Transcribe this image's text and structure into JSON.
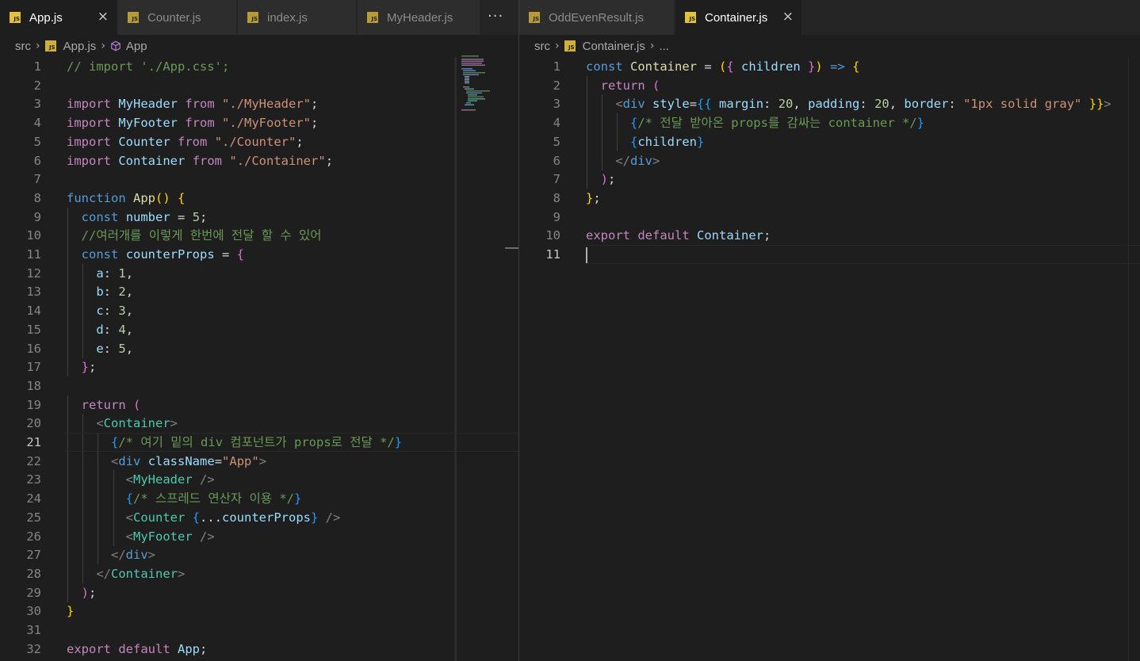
{
  "left_pane": {
    "tabs": [
      {
        "label": "App.js",
        "active": true,
        "close_icon": "×"
      },
      {
        "label": "Counter.js",
        "active": false
      },
      {
        "label": "index.js",
        "active": false
      },
      {
        "label": "MyHeader.js",
        "active": false
      }
    ],
    "more_tabs": "···",
    "breadcrumb": {
      "folder": "src",
      "file": "App.js",
      "symbol": "App"
    }
  },
  "right_pane": {
    "tabs": [
      {
        "label": "OddEvenResult.js",
        "active": false
      },
      {
        "label": "Container.js",
        "active": true,
        "close_icon": "×"
      }
    ],
    "breadcrumb": {
      "folder": "src",
      "file": "Container.js",
      "symbol": "..."
    }
  },
  "app_js": {
    "active_line": 21,
    "lines": [
      [
        {
          "t": "// import './App.css';",
          "c": "cmt"
        }
      ],
      [],
      [
        {
          "t": "import",
          "c": "ctl"
        },
        {
          "t": " "
        },
        {
          "t": "MyHeader",
          "c": "var"
        },
        {
          "t": " "
        },
        {
          "t": "from",
          "c": "ctl"
        },
        {
          "t": " "
        },
        {
          "t": "\"./MyHeader\"",
          "c": "str"
        },
        {
          "t": ";",
          "c": "pun"
        }
      ],
      [
        {
          "t": "import",
          "c": "ctl"
        },
        {
          "t": " "
        },
        {
          "t": "MyFooter",
          "c": "var"
        },
        {
          "t": " "
        },
        {
          "t": "from",
          "c": "ctl"
        },
        {
          "t": " "
        },
        {
          "t": "\"./MyFooter\"",
          "c": "str"
        },
        {
          "t": ";",
          "c": "pun"
        }
      ],
      [
        {
          "t": "import",
          "c": "ctl"
        },
        {
          "t": " "
        },
        {
          "t": "Counter",
          "c": "var"
        },
        {
          "t": " "
        },
        {
          "t": "from",
          "c": "ctl"
        },
        {
          "t": " "
        },
        {
          "t": "\"./Counter\"",
          "c": "str"
        },
        {
          "t": ";",
          "c": "pun"
        }
      ],
      [
        {
          "t": "import",
          "c": "ctl"
        },
        {
          "t": " "
        },
        {
          "t": "Container",
          "c": "var"
        },
        {
          "t": " "
        },
        {
          "t": "from",
          "c": "ctl"
        },
        {
          "t": " "
        },
        {
          "t": "\"./Container\"",
          "c": "str"
        },
        {
          "t": ";",
          "c": "pun"
        }
      ],
      [],
      [
        {
          "t": "function",
          "c": "kw"
        },
        {
          "t": " "
        },
        {
          "t": "App",
          "c": "fn"
        },
        {
          "t": "()",
          "c": "br1"
        },
        {
          "t": " "
        },
        {
          "t": "{",
          "c": "br1"
        }
      ],
      [
        {
          "t": "  "
        },
        {
          "t": "const",
          "c": "kw"
        },
        {
          "t": " "
        },
        {
          "t": "number",
          "c": "var"
        },
        {
          "t": " = ",
          "c": "pun"
        },
        {
          "t": "5",
          "c": "num"
        },
        {
          "t": ";",
          "c": "pun"
        }
      ],
      [
        {
          "t": "  "
        },
        {
          "t": "//여러개를 이렇게 한번에 전달 할 수 있어",
          "c": "cmt"
        }
      ],
      [
        {
          "t": "  "
        },
        {
          "t": "const",
          "c": "kw"
        },
        {
          "t": " "
        },
        {
          "t": "counterProps",
          "c": "var"
        },
        {
          "t": " = ",
          "c": "pun"
        },
        {
          "t": "{",
          "c": "br2"
        }
      ],
      [
        {
          "t": "    "
        },
        {
          "t": "a",
          "c": "var"
        },
        {
          "t": ": ",
          "c": "pun"
        },
        {
          "t": "1",
          "c": "num"
        },
        {
          "t": ",",
          "c": "pun"
        }
      ],
      [
        {
          "t": "    "
        },
        {
          "t": "b",
          "c": "var"
        },
        {
          "t": ": ",
          "c": "pun"
        },
        {
          "t": "2",
          "c": "num"
        },
        {
          "t": ",",
          "c": "pun"
        }
      ],
      [
        {
          "t": "    "
        },
        {
          "t": "c",
          "c": "var"
        },
        {
          "t": ": ",
          "c": "pun"
        },
        {
          "t": "3",
          "c": "num"
        },
        {
          "t": ",",
          "c": "pun"
        }
      ],
      [
        {
          "t": "    "
        },
        {
          "t": "d",
          "c": "var"
        },
        {
          "t": ": ",
          "c": "pun"
        },
        {
          "t": "4",
          "c": "num"
        },
        {
          "t": ",",
          "c": "pun"
        }
      ],
      [
        {
          "t": "    "
        },
        {
          "t": "e",
          "c": "var"
        },
        {
          "t": ": ",
          "c": "pun"
        },
        {
          "t": "5",
          "c": "num"
        },
        {
          "t": ",",
          "c": "pun"
        }
      ],
      [
        {
          "t": "  "
        },
        {
          "t": "}",
          "c": "br2"
        },
        {
          "t": ";",
          "c": "pun"
        }
      ],
      [],
      [
        {
          "t": "  "
        },
        {
          "t": "return",
          "c": "ctl"
        },
        {
          "t": " "
        },
        {
          "t": "(",
          "c": "br2"
        }
      ],
      [
        {
          "t": "    "
        },
        {
          "t": "<",
          "c": "ang"
        },
        {
          "t": "Container",
          "c": "tag"
        },
        {
          "t": ">",
          "c": "ang"
        }
      ],
      [
        {
          "t": "      "
        },
        {
          "t": "{",
          "c": "br3"
        },
        {
          "t": "/* 여기 밑의 div 컴포넌트가 props로 전달 */",
          "c": "cmt"
        },
        {
          "t": "}",
          "c": "br3"
        }
      ],
      [
        {
          "t": "      "
        },
        {
          "t": "<",
          "c": "ang"
        },
        {
          "t": "div",
          "c": "kw"
        },
        {
          "t": " "
        },
        {
          "t": "className",
          "c": "var"
        },
        {
          "t": "=",
          "c": "pun"
        },
        {
          "t": "\"App\"",
          "c": "str"
        },
        {
          "t": ">",
          "c": "ang"
        }
      ],
      [
        {
          "t": "        "
        },
        {
          "t": "<",
          "c": "ang"
        },
        {
          "t": "MyHeader",
          "c": "tag"
        },
        {
          "t": " />",
          "c": "ang"
        }
      ],
      [
        {
          "t": "        "
        },
        {
          "t": "{",
          "c": "br3"
        },
        {
          "t": "/* 스프레드 연산자 이용 */",
          "c": "cmt"
        },
        {
          "t": "}",
          "c": "br3"
        }
      ],
      [
        {
          "t": "        "
        },
        {
          "t": "<",
          "c": "ang"
        },
        {
          "t": "Counter",
          "c": "tag"
        },
        {
          "t": " "
        },
        {
          "t": "{",
          "c": "br3"
        },
        {
          "t": "...",
          "c": "pun"
        },
        {
          "t": "counterProps",
          "c": "var"
        },
        {
          "t": "}",
          "c": "br3"
        },
        {
          "t": " />",
          "c": "ang"
        }
      ],
      [
        {
          "t": "        "
        },
        {
          "t": "<",
          "c": "ang"
        },
        {
          "t": "MyFooter",
          "c": "tag"
        },
        {
          "t": " />",
          "c": "ang"
        }
      ],
      [
        {
          "t": "      "
        },
        {
          "t": "</",
          "c": "ang"
        },
        {
          "t": "div",
          "c": "kw"
        },
        {
          "t": ">",
          "c": "ang"
        }
      ],
      [
        {
          "t": "    "
        },
        {
          "t": "</",
          "c": "ang"
        },
        {
          "t": "Container",
          "c": "tag"
        },
        {
          "t": ">",
          "c": "ang"
        }
      ],
      [
        {
          "t": "  "
        },
        {
          "t": ")",
          "c": "br2"
        },
        {
          "t": ";",
          "c": "pun"
        }
      ],
      [
        {
          "t": "}",
          "c": "br1"
        }
      ],
      [],
      [
        {
          "t": "export",
          "c": "ctl"
        },
        {
          "t": " "
        },
        {
          "t": "default",
          "c": "ctl"
        },
        {
          "t": " "
        },
        {
          "t": "App",
          "c": "var"
        },
        {
          "t": ";",
          "c": "pun"
        }
      ]
    ]
  },
  "container_js": {
    "active_line": 11,
    "lines": [
      [
        {
          "t": "const",
          "c": "kw"
        },
        {
          "t": " "
        },
        {
          "t": "Container",
          "c": "fn"
        },
        {
          "t": " = ",
          "c": "pun"
        },
        {
          "t": "(",
          "c": "br1"
        },
        {
          "t": "{",
          "c": "br2"
        },
        {
          "t": " "
        },
        {
          "t": "children",
          "c": "var"
        },
        {
          "t": " "
        },
        {
          "t": "}",
          "c": "br2"
        },
        {
          "t": ")",
          "c": "br1"
        },
        {
          "t": " "
        },
        {
          "t": "=>",
          "c": "kw"
        },
        {
          "t": " "
        },
        {
          "t": "{",
          "c": "br1"
        }
      ],
      [
        {
          "t": "  "
        },
        {
          "t": "return",
          "c": "ctl"
        },
        {
          "t": " "
        },
        {
          "t": "(",
          "c": "br2"
        }
      ],
      [
        {
          "t": "    "
        },
        {
          "t": "<",
          "c": "ang"
        },
        {
          "t": "div",
          "c": "kw"
        },
        {
          "t": " "
        },
        {
          "t": "style",
          "c": "var"
        },
        {
          "t": "=",
          "c": "pun"
        },
        {
          "t": "{{",
          "c": "br3"
        },
        {
          "t": " "
        },
        {
          "t": "margin",
          "c": "var"
        },
        {
          "t": ": ",
          "c": "pun"
        },
        {
          "t": "20",
          "c": "num"
        },
        {
          "t": ", ",
          "c": "pun"
        },
        {
          "t": "padding",
          "c": "var"
        },
        {
          "t": ": ",
          "c": "pun"
        },
        {
          "t": "20",
          "c": "num"
        },
        {
          "t": ", ",
          "c": "pun"
        },
        {
          "t": "border",
          "c": "var"
        },
        {
          "t": ": ",
          "c": "pun"
        },
        {
          "t": "\"1px solid gray\"",
          "c": "str"
        },
        {
          "t": " "
        },
        {
          "t": "}}",
          "c": "br1"
        },
        {
          "t": ">",
          "c": "ang"
        }
      ],
      [
        {
          "t": "      "
        },
        {
          "t": "{",
          "c": "br3"
        },
        {
          "t": "/* 전달 받아온 props를 감싸는 container */",
          "c": "cmt"
        },
        {
          "t": "}",
          "c": "br3"
        }
      ],
      [
        {
          "t": "      "
        },
        {
          "t": "{",
          "c": "br3"
        },
        {
          "t": "children",
          "c": "var"
        },
        {
          "t": "}",
          "c": "br3"
        }
      ],
      [
        {
          "t": "    "
        },
        {
          "t": "</",
          "c": "ang"
        },
        {
          "t": "div",
          "c": "kw"
        },
        {
          "t": ">",
          "c": "ang"
        }
      ],
      [
        {
          "t": "  "
        },
        {
          "t": ")",
          "c": "br2"
        },
        {
          "t": ";",
          "c": "pun"
        }
      ],
      [
        {
          "t": "}",
          "c": "br1"
        },
        {
          "t": ";",
          "c": "pun"
        }
      ],
      [],
      [
        {
          "t": "export",
          "c": "ctl"
        },
        {
          "t": " "
        },
        {
          "t": "default",
          "c": "ctl"
        },
        {
          "t": " "
        },
        {
          "t": "Container",
          "c": "var"
        },
        {
          "t": ";",
          "c": "pun"
        }
      ],
      []
    ]
  }
}
